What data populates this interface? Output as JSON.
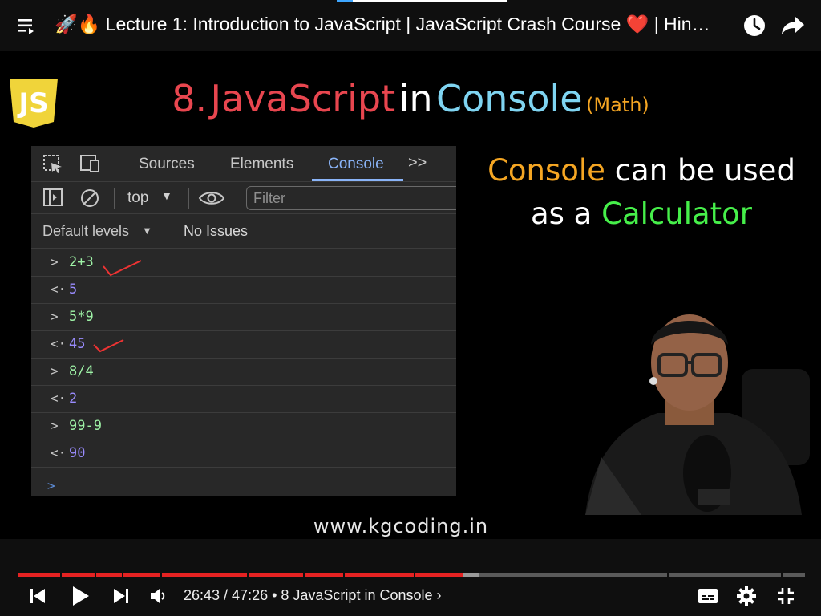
{
  "header": {
    "title": "🚀🔥 Lecture 1: Introduction to JavaScript | JavaScript Crash Course ❤️ | Hin…"
  },
  "slide": {
    "heading_num": "8.",
    "heading_js": "JavaScript",
    "heading_in": "in",
    "heading_console": "Console",
    "heading_sub": "(Math)",
    "logo_text": "JS",
    "calc_line1_a": "Console",
    "calc_line1_b": " can be used",
    "calc_line2_a": "as a ",
    "calc_line2_b": "Calculator",
    "website": "www.kgcoding.in"
  },
  "devtools": {
    "tabs": [
      "Sources",
      "Elements",
      "Console"
    ],
    "more_tabs": ">>",
    "context": "top",
    "filter_placeholder": "Filter",
    "levels": "Default levels",
    "issues": "No Issues",
    "lines": [
      {
        "kind": "input",
        "arrow": ">",
        "text": "2+3"
      },
      {
        "kind": "result",
        "arrow": "<·",
        "text": "5"
      },
      {
        "kind": "input",
        "arrow": ">",
        "text": "5*9"
      },
      {
        "kind": "result",
        "arrow": "<·",
        "text": "45"
      },
      {
        "kind": "input",
        "arrow": ">",
        "text": "8/4"
      },
      {
        "kind": "result",
        "arrow": "<·",
        "text": "2"
      },
      {
        "kind": "input",
        "arrow": ">",
        "text": "99-9"
      },
      {
        "kind": "result",
        "arrow": "<·",
        "text": "90"
      }
    ],
    "prompt": ">"
  },
  "player": {
    "progress": 0.565,
    "time": "26:43 / 47:26",
    "chapter": " • 8 JavaScript in Console ›"
  },
  "colors": {
    "accent_red": "#e52222",
    "console_blue": "#8ab4f8",
    "input_green": "#9ef2a6",
    "result_purple": "#9a8cff"
  }
}
